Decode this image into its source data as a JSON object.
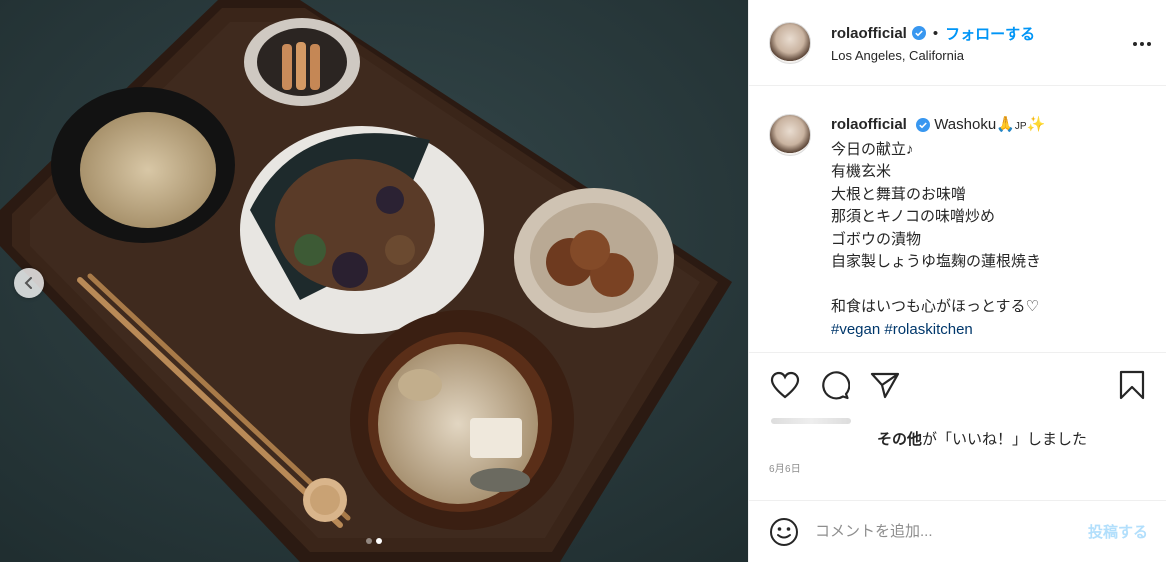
{
  "media": {
    "alt_icons": {
      "prev": "chevron-left-icon"
    },
    "carousel": {
      "count": 2,
      "active_index": 1
    }
  },
  "header": {
    "username": "rolaofficial",
    "separator": "•",
    "follow_label": "フォローする",
    "location": "Los Angeles, California",
    "more_icon": "more-horizontal-icon"
  },
  "caption": {
    "username": "rolaofficial",
    "first_line_text": "Washoku🙏",
    "first_line_jp_flag": "JP",
    "first_line_emoji": "✨",
    "lines": [
      "今日の献立♪",
      "有機玄米",
      "大根と舞茸のお味噌",
      "那須とキノコの味噌炒め",
      "ゴボウの漬物",
      "自家製しょうゆ塩麹の蓮根焼き",
      "",
      "和食はいつも心がほっとする♡"
    ],
    "hashtags": "#vegan #rolaskitchen"
  },
  "actions": {
    "like_icon": "heart-icon",
    "comment_icon": "comment-icon",
    "share_icon": "paper-plane-icon",
    "save_icon": "bookmark-icon"
  },
  "likes": {
    "others_label": "その他",
    "suffix": "が「いいね！」しました"
  },
  "date": "6月6日",
  "comment": {
    "emoji_icon": "smiley-icon",
    "placeholder": "コメントを追加...",
    "post_label": "投稿する"
  },
  "colors": {
    "link_blue": "#0095f6",
    "post_button_disabled": "#b2dffc",
    "hashtag": "#00376b",
    "verified": "#3897f0"
  }
}
